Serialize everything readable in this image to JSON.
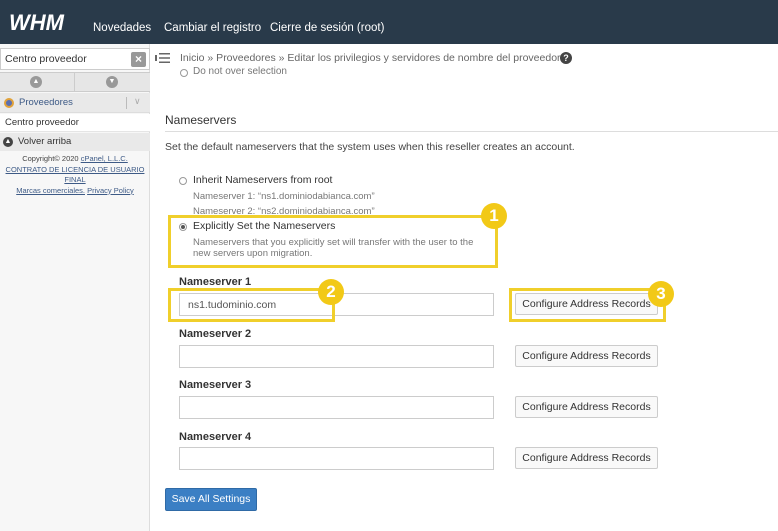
{
  "topbar": {
    "logo_text": "WHM",
    "nav": [
      "Novedades",
      "Cambiar el registro",
      "Cierre de sesión (root)"
    ]
  },
  "breadcrumb": {
    "text": "Inicio » Proveedores » Editar los privilegios y servidores de nombre del proveedor",
    "help_icon": "question-circle-icon"
  },
  "sidebar": {
    "search_value": "Centro proveedor",
    "category": "Proveedores",
    "item": "Centro proveedor",
    "back": "Volver arriba",
    "footer": {
      "copyright": "Copyright© 2020",
      "company": "cPanel, L.L.C.",
      "eula": "CONTRATO DE LICENCIA DE USUARIO FINAL",
      "trademarks": "Marcas comerciales.",
      "privacy": "Privacy Policy"
    }
  },
  "main": {
    "cut_text": "Do not over selection",
    "section_title": "Nameservers",
    "section_desc": "Set the default nameservers that the system uses when this reseller creates an account.",
    "option_inherit": {
      "label": "Inherit Nameservers from root",
      "ns1": "Nameserver 1: “ns1.dominiodabianca.com”",
      "ns2": "Nameserver 2: “ns2.dominiodabianca.com”"
    },
    "option_explicit": {
      "label": "Explicitly Set the Nameservers",
      "desc_line1": "Nameservers that you explicitly set will transfer with the user to the",
      "desc_line2": "new servers upon migration."
    },
    "nameservers": [
      {
        "label": "Nameserver 1",
        "value": "ns1.tudominio.com",
        "button": "Configure Address Records"
      },
      {
        "label": "Nameserver 2",
        "value": "",
        "button": "Configure Address Records"
      },
      {
        "label": "Nameserver 3",
        "value": "",
        "button": "Configure Address Records"
      },
      {
        "label": "Nameserver 4",
        "value": "",
        "button": "Configure Address Records"
      }
    ],
    "save_button": "Save All Settings"
  },
  "annotations": [
    "1",
    "2",
    "3"
  ],
  "colors": {
    "topbar": "#293a4a",
    "highlight": "#f0cf2b",
    "primary_button": "#3b7fc4"
  }
}
